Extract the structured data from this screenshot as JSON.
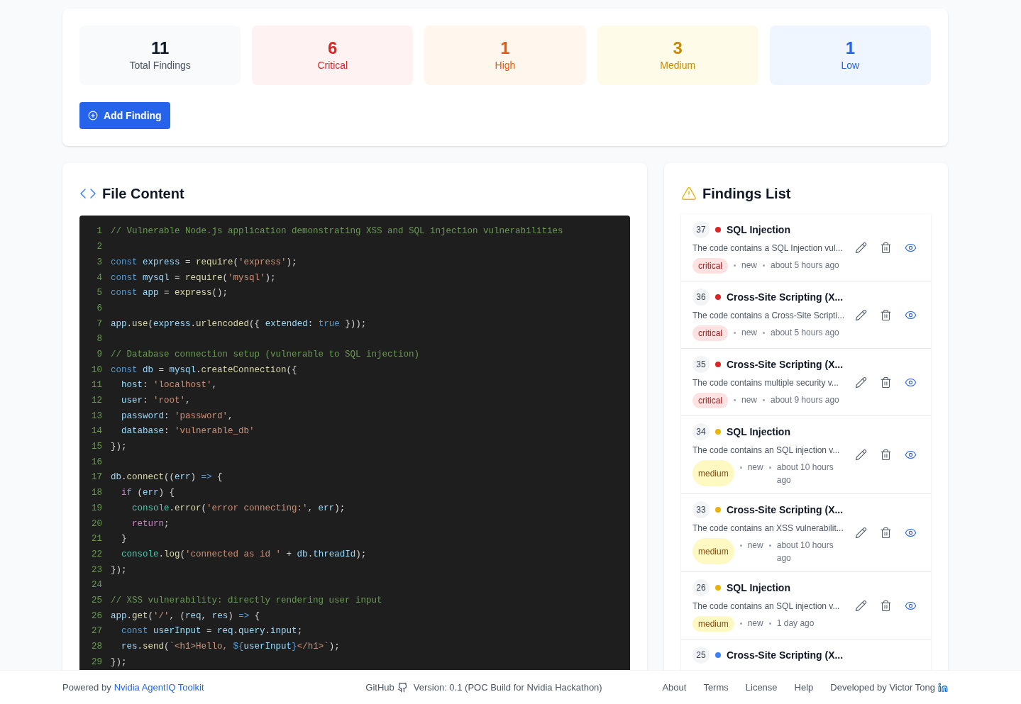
{
  "stats": [
    {
      "value": "11",
      "label": "Total Findings",
      "kind": "total"
    },
    {
      "value": "6",
      "label": "Critical",
      "kind": "critical"
    },
    {
      "value": "1",
      "label": "High",
      "kind": "high"
    },
    {
      "value": "3",
      "label": "Medium",
      "kind": "medium"
    },
    {
      "value": "1",
      "label": "Low",
      "kind": "low"
    }
  ],
  "add_button": "Add Finding",
  "file_content": {
    "title": "File Content",
    "lines": [
      {
        "n": "1",
        "tokens": [
          {
            "t": "// Vulnerable Node.js application demonstrating XSS and SQL injection vulnerabilities",
            "kind": "comment"
          }
        ]
      },
      {
        "n": "2"
      },
      {
        "n": "3",
        "tokens": [
          {
            "t": "const ",
            "kind": "keyword"
          },
          {
            "t": "express",
            "kind": "var"
          },
          {
            "t": " = ",
            "kind": "plain"
          },
          {
            "t": "require",
            "kind": "func"
          },
          {
            "t": "(",
            "kind": "plain"
          },
          {
            "t": "'express'",
            "kind": "string"
          },
          {
            "t": ");",
            "kind": "plain"
          }
        ]
      },
      {
        "n": "4",
        "tokens": [
          {
            "t": "const ",
            "kind": "keyword"
          },
          {
            "t": "mysql",
            "kind": "var"
          },
          {
            "t": " = ",
            "kind": "plain"
          },
          {
            "t": "require",
            "kind": "func"
          },
          {
            "t": "(",
            "kind": "plain"
          },
          {
            "t": "'mysql'",
            "kind": "string"
          },
          {
            "t": ");",
            "kind": "plain"
          }
        ]
      },
      {
        "n": "5",
        "tokens": [
          {
            "t": "const ",
            "kind": "keyword"
          },
          {
            "t": "app",
            "kind": "var"
          },
          {
            "t": " = ",
            "kind": "plain"
          },
          {
            "t": "express",
            "kind": "func"
          },
          {
            "t": "();",
            "kind": "plain"
          }
        ]
      },
      {
        "n": "6"
      },
      {
        "n": "7",
        "tokens": [
          {
            "t": "app",
            "kind": "var"
          },
          {
            "t": ".",
            "kind": "plain"
          },
          {
            "t": "use",
            "kind": "func"
          },
          {
            "t": "(",
            "kind": "plain"
          },
          {
            "t": "express",
            "kind": "var"
          },
          {
            "t": ".",
            "kind": "plain"
          },
          {
            "t": "urlencoded",
            "kind": "func"
          },
          {
            "t": "({ ",
            "kind": "plain"
          },
          {
            "t": "extended",
            "kind": "var"
          },
          {
            "t": ": ",
            "kind": "plain"
          },
          {
            "t": "true",
            "kind": "keyword"
          },
          {
            "t": " }));",
            "kind": "plain"
          }
        ]
      },
      {
        "n": "8"
      },
      {
        "n": "9",
        "tokens": [
          {
            "t": "// Database connection setup (vulnerable to SQL injection)",
            "kind": "comment"
          }
        ]
      },
      {
        "n": "10",
        "tokens": [
          {
            "t": "const ",
            "kind": "keyword"
          },
          {
            "t": "db",
            "kind": "var"
          },
          {
            "t": " = ",
            "kind": "plain"
          },
          {
            "t": "mysql",
            "kind": "var"
          },
          {
            "t": ".",
            "kind": "plain"
          },
          {
            "t": "createConnection",
            "kind": "func"
          },
          {
            "t": "({",
            "kind": "plain"
          }
        ]
      },
      {
        "n": "11",
        "tokens": [
          {
            "t": "  host",
            "kind": "var"
          },
          {
            "t": ": ",
            "kind": "plain"
          },
          {
            "t": "'localhost'",
            "kind": "string"
          },
          {
            "t": ",",
            "kind": "plain"
          }
        ]
      },
      {
        "n": "12",
        "tokens": [
          {
            "t": "  user",
            "kind": "var"
          },
          {
            "t": ": ",
            "kind": "plain"
          },
          {
            "t": "'root'",
            "kind": "string"
          },
          {
            "t": ",",
            "kind": "plain"
          }
        ]
      },
      {
        "n": "13",
        "tokens": [
          {
            "t": "  password",
            "kind": "var"
          },
          {
            "t": ": ",
            "kind": "plain"
          },
          {
            "t": "'password'",
            "kind": "string"
          },
          {
            "t": ",",
            "kind": "plain"
          }
        ]
      },
      {
        "n": "14",
        "tokens": [
          {
            "t": "  database",
            "kind": "var"
          },
          {
            "t": ": ",
            "kind": "plain"
          },
          {
            "t": "'vulnerable_db'",
            "kind": "string"
          }
        ]
      },
      {
        "n": "15",
        "tokens": [
          {
            "t": "});",
            "kind": "plain"
          }
        ]
      },
      {
        "n": "16"
      },
      {
        "n": "17",
        "tokens": [
          {
            "t": "db",
            "kind": "var"
          },
          {
            "t": ".",
            "kind": "plain"
          },
          {
            "t": "connect",
            "kind": "func"
          },
          {
            "t": "((",
            "kind": "plain"
          },
          {
            "t": "err",
            "kind": "var"
          },
          {
            "t": ") ",
            "kind": "plain"
          },
          {
            "t": "=>",
            "kind": "keyword"
          },
          {
            "t": " {",
            "kind": "plain"
          }
        ]
      },
      {
        "n": "18",
        "tokens": [
          {
            "t": "  if",
            "kind": "control"
          },
          {
            "t": " (",
            "kind": "plain"
          },
          {
            "t": "err",
            "kind": "var"
          },
          {
            "t": ") {",
            "kind": "plain"
          }
        ]
      },
      {
        "n": "19",
        "tokens": [
          {
            "t": "    console",
            "kind": "object"
          },
          {
            "t": ".",
            "kind": "plain"
          },
          {
            "t": "error",
            "kind": "func"
          },
          {
            "t": "(",
            "kind": "plain"
          },
          {
            "t": "'error connecting:'",
            "kind": "string"
          },
          {
            "t": ", ",
            "kind": "plain"
          },
          {
            "t": "err",
            "kind": "var"
          },
          {
            "t": ");",
            "kind": "plain"
          }
        ]
      },
      {
        "n": "20",
        "tokens": [
          {
            "t": "    return",
            "kind": "control"
          },
          {
            "t": ";",
            "kind": "plain"
          }
        ]
      },
      {
        "n": "21",
        "tokens": [
          {
            "t": "  }",
            "kind": "plain"
          }
        ]
      },
      {
        "n": "22",
        "tokens": [
          {
            "t": "  console",
            "kind": "object"
          },
          {
            "t": ".",
            "kind": "plain"
          },
          {
            "t": "log",
            "kind": "func"
          },
          {
            "t": "(",
            "kind": "plain"
          },
          {
            "t": "'connected as id '",
            "kind": "string"
          },
          {
            "t": " + ",
            "kind": "plain"
          },
          {
            "t": "db",
            "kind": "var"
          },
          {
            "t": ".",
            "kind": "plain"
          },
          {
            "t": "threadId",
            "kind": "var"
          },
          {
            "t": ");",
            "kind": "plain"
          }
        ]
      },
      {
        "n": "23",
        "tokens": [
          {
            "t": "});",
            "kind": "plain"
          }
        ]
      },
      {
        "n": "24"
      },
      {
        "n": "25",
        "tokens": [
          {
            "t": "// XSS vulnerability: directly rendering user input",
            "kind": "comment"
          }
        ]
      },
      {
        "n": "26",
        "tokens": [
          {
            "t": "app",
            "kind": "var"
          },
          {
            "t": ".",
            "kind": "plain"
          },
          {
            "t": "get",
            "kind": "func"
          },
          {
            "t": "(",
            "kind": "plain"
          },
          {
            "t": "'/'",
            "kind": "string"
          },
          {
            "t": ", (",
            "kind": "plain"
          },
          {
            "t": "req",
            "kind": "var"
          },
          {
            "t": ", ",
            "kind": "plain"
          },
          {
            "t": "res",
            "kind": "var"
          },
          {
            "t": ") ",
            "kind": "plain"
          },
          {
            "t": "=>",
            "kind": "keyword"
          },
          {
            "t": " {",
            "kind": "plain"
          }
        ]
      },
      {
        "n": "27",
        "tokens": [
          {
            "t": "  const ",
            "kind": "keyword"
          },
          {
            "t": "userInput",
            "kind": "var"
          },
          {
            "t": " = ",
            "kind": "plain"
          },
          {
            "t": "req",
            "kind": "var"
          },
          {
            "t": ".",
            "kind": "plain"
          },
          {
            "t": "query",
            "kind": "var"
          },
          {
            "t": ".",
            "kind": "plain"
          },
          {
            "t": "input",
            "kind": "var"
          },
          {
            "t": ";",
            "kind": "plain"
          }
        ]
      },
      {
        "n": "28",
        "tokens": [
          {
            "t": "  res",
            "kind": "var"
          },
          {
            "t": ".",
            "kind": "plain"
          },
          {
            "t": "send",
            "kind": "func"
          },
          {
            "t": "(",
            "kind": "plain"
          },
          {
            "t": "`<h1>Hello, ",
            "kind": "string"
          },
          {
            "t": "${",
            "kind": "keyword"
          },
          {
            "t": "userInput",
            "kind": "var"
          },
          {
            "t": "}",
            "kind": "keyword"
          },
          {
            "t": "</h1>`",
            "kind": "string"
          },
          {
            "t": ");",
            "kind": "plain"
          }
        ]
      },
      {
        "n": "29",
        "tokens": [
          {
            "t": "});",
            "kind": "plain"
          }
        ]
      }
    ]
  },
  "findings": {
    "title": "Findings List",
    "items": [
      {
        "id": "37",
        "color": "#dc2626",
        "title": "SQL Injection",
        "description": "The code contains a SQL Injection vul...",
        "severity": "critical",
        "status": "new",
        "time": "about 5 hours ago"
      },
      {
        "id": "36",
        "color": "#dc2626",
        "title": "Cross-Site Scripting (X...",
        "description": "The code contains a Cross-Site Scripti...",
        "severity": "critical",
        "status": "new",
        "time": "about 5 hours ago"
      },
      {
        "id": "35",
        "color": "#dc2626",
        "title": "Cross-Site Scripting (X...",
        "description": "The code contains multiple security v...",
        "severity": "critical",
        "status": "new",
        "time": "about 9 hours ago"
      },
      {
        "id": "34",
        "color": "#eab308",
        "title": "SQL Injection",
        "description": "The code contains an SQL injection v...",
        "severity": "medium",
        "status": "new",
        "time": "about 10 hours ago"
      },
      {
        "id": "33",
        "color": "#eab308",
        "title": "Cross-Site Scripting (X...",
        "description": "The code contains an XSS vulnerabilit...",
        "severity": "medium",
        "status": "new",
        "time": "about 10 hours ago"
      },
      {
        "id": "26",
        "color": "#eab308",
        "title": "SQL Injection",
        "description": "The code contains an SQL injection v...",
        "severity": "medium",
        "status": "new",
        "time": "1 day ago"
      },
      {
        "id": "25",
        "color": "#3b82f6",
        "title": "Cross-Site Scripting (X..."
      }
    ]
  },
  "footer": {
    "powered_by": "Powered by",
    "toolkit_link": "Nvidia AgentIQ Toolkit",
    "github": "GitHub",
    "version": "Version: 0.1 (POC Build for Nvidia Hackathon)",
    "links": [
      "About",
      "Terms",
      "License",
      "Help"
    ],
    "developer": "Developed by Victor Tong"
  }
}
